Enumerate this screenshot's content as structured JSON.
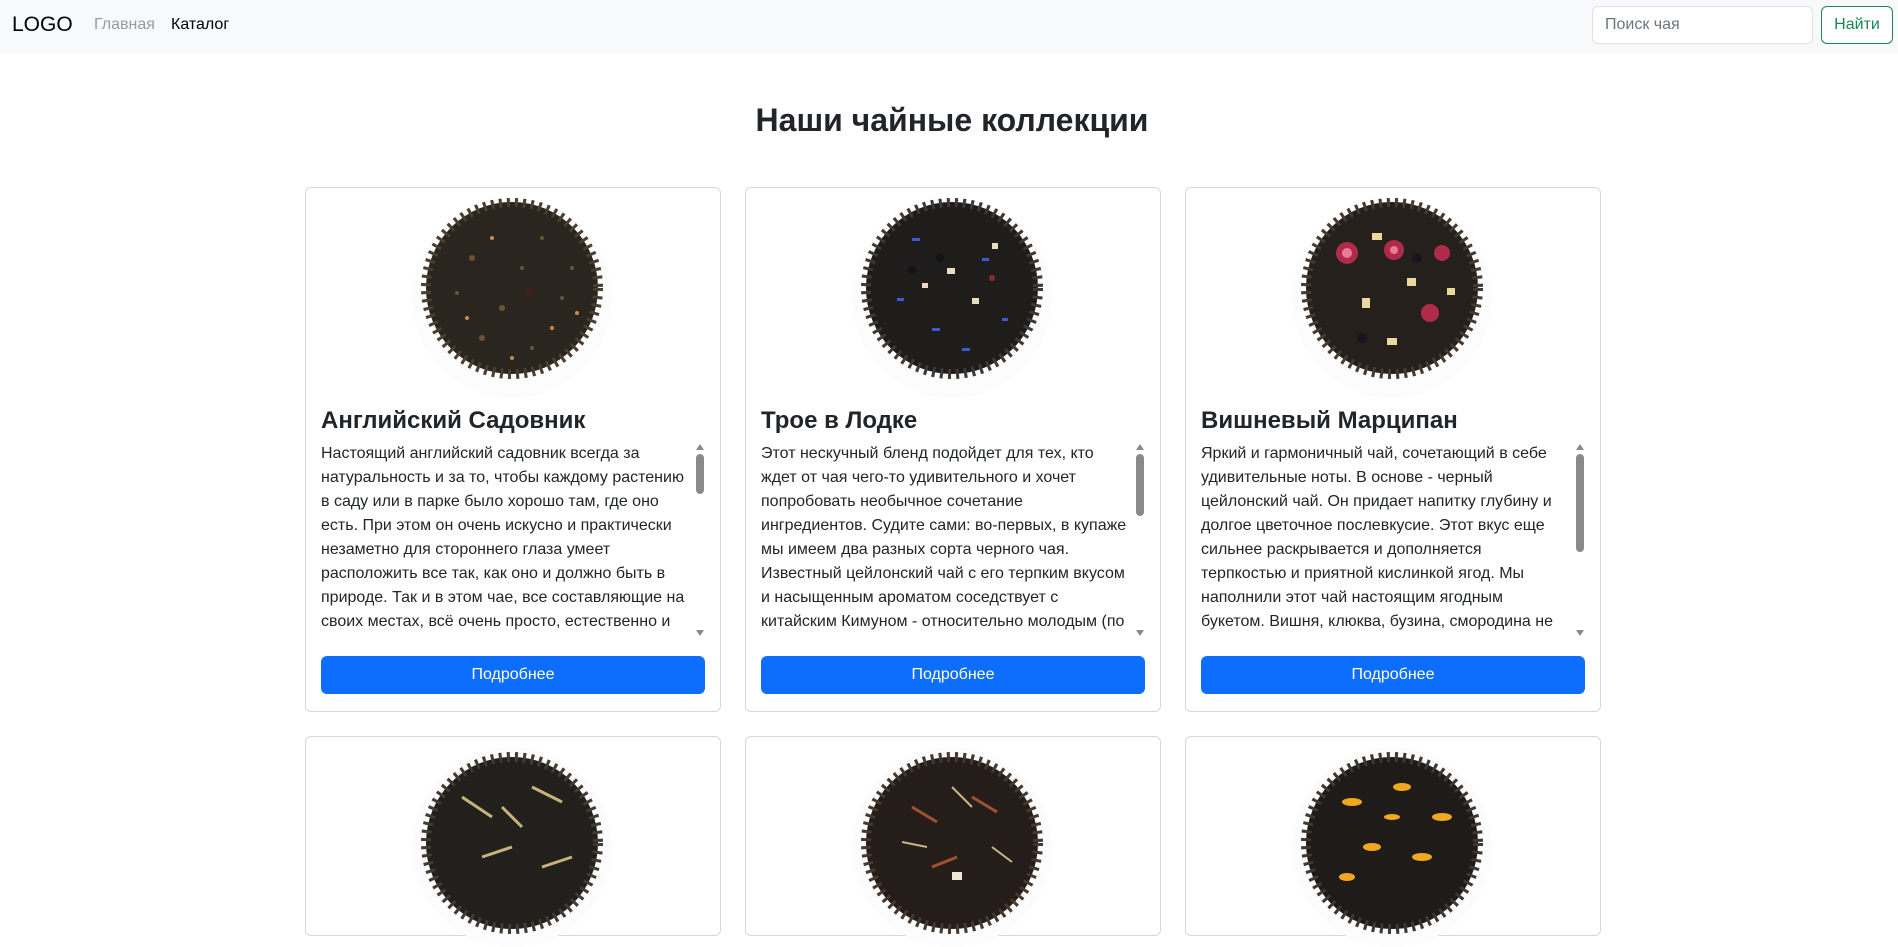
{
  "navbar": {
    "brand": "LOGO",
    "links": [
      {
        "label": "Главная",
        "active": false
      },
      {
        "label": "Каталог",
        "active": true
      }
    ],
    "search_placeholder": "Поиск чая",
    "search_button": "Найти"
  },
  "main": {
    "title": "Наши чайные коллекции",
    "cards": [
      {
        "title": "Английский Садовник",
        "description": "Настоящий английский садовник всегда за натуральность и за то, чтобы каждому растению в саду или в парке было хорошо там, где оно есть. При этом он очень искусно и практически незаметно для стороннего глаза умеет расположить все так, как оно и должно быть в природе. Так и в этом чае, все составляющие на своих местах, всё очень просто, естественно и без лишних украшений. Такой чай хорош",
        "button": "Подробнее",
        "image_icon": "loose-black-tea-icon"
      },
      {
        "title": "Трое в Лодке",
        "description": "Этот нескучный бленд подойдет для тех, кто ждет от чая чего-то удивительного и хочет попробовать необычное сочетание ингредиентов. Судите сами: во-первых, в купаже мы имеем два разных сорта черного чая. Известный цейлонский чай с его терпким вкусом и насыщенным ароматом соседствует с китайским Кимуном - относительно молодым (по меркам чайной истории) сортом черного чая",
        "button": "Подробнее",
        "image_icon": "tea-with-cornflower-icon"
      },
      {
        "title": "Вишневый Марципан",
        "description": "Яркий и гармоничный чай, сочетающий в себе удивительные ноты. В основе - черный цейлонский чай. Он придает напитку глубину и долгое цветочное послевкусие. Этот вкус еще сильнее раскрывается и дополняется терпкостью и приятной кислинкой ягод. Мы наполнили этот чай настоящим ягодным букетом. Вишня, клюква, бузина, смородина не оставят равнодушным",
        "button": "Подробнее",
        "image_icon": "tea-with-berries-icon"
      },
      {
        "title": "",
        "description": "",
        "button": "",
        "image_icon": "tea-with-lemongrass-icon"
      },
      {
        "title": "",
        "description": "",
        "button": "",
        "image_icon": "tea-with-herbs-icon"
      },
      {
        "title": "",
        "description": "",
        "button": "",
        "image_icon": "tea-with-marigold-icon"
      }
    ]
  },
  "colors": {
    "navbar_bg": "#f8f9fa",
    "primary": "#0d6efd",
    "success": "#198754",
    "text": "#212529"
  }
}
